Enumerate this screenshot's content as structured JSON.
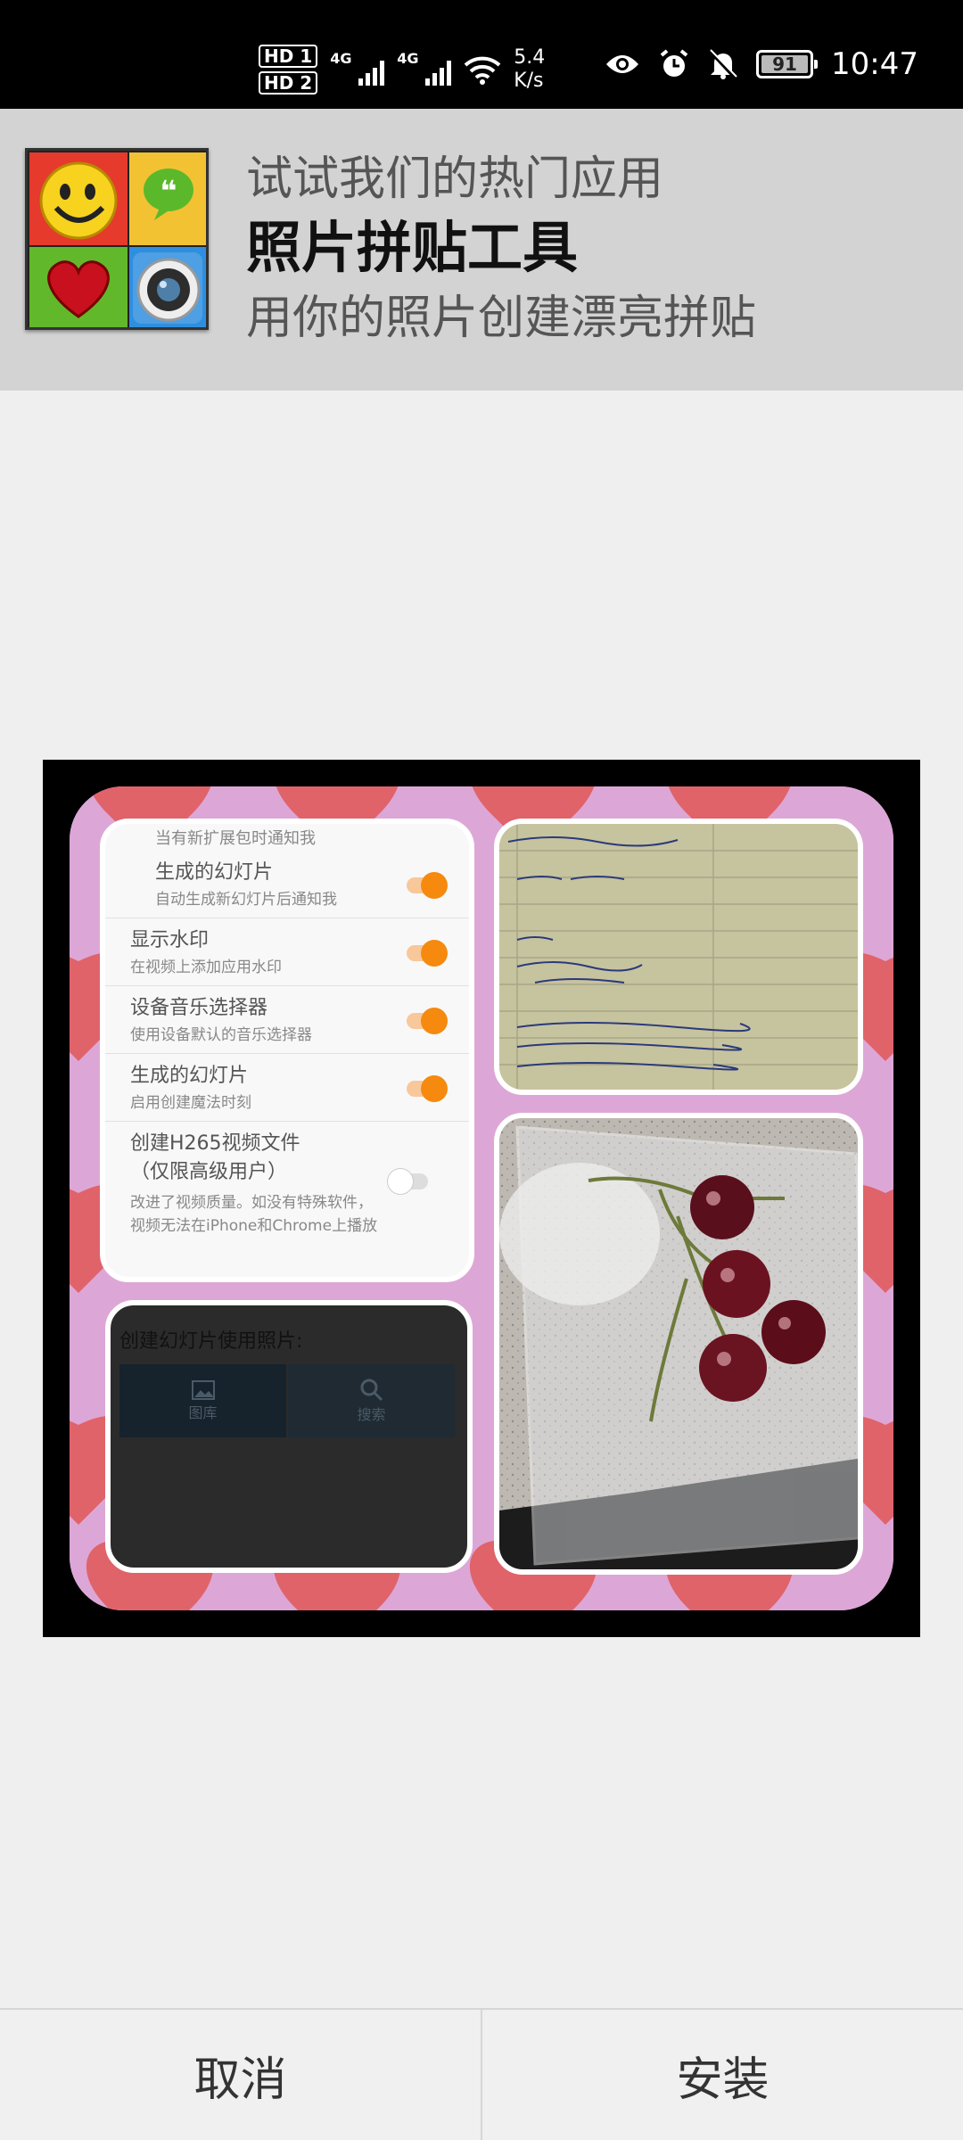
{
  "status_bar": {
    "hd1": "HD 1",
    "hd2": "HD 2",
    "net1": "4G",
    "net2": "4G",
    "speed_value": "5.4",
    "speed_unit": "K/s",
    "battery": "91",
    "time": "10:47",
    "icons": [
      "eye-icon",
      "alarm-icon",
      "bell-off-icon"
    ]
  },
  "banner": {
    "line1": "试试我们的热门应用",
    "app_name": "照片拼贴工具",
    "line3": "用你的照片创建漂亮拼贴"
  },
  "preview": {
    "settings_panel": {
      "top_partial": "当有新扩展包时通知我",
      "rows": [
        {
          "title": "生成的幻灯片",
          "subtitle": "自动生成新幻灯片后通知我",
          "on": true
        },
        {
          "title": "显示水印",
          "subtitle": "在视频上添加应用水印",
          "on": true
        },
        {
          "title": "设备音乐选择器",
          "subtitle": "使用设备默认的音乐选择器",
          "on": true
        },
        {
          "title": "生成的幻灯片",
          "subtitle": "启用创建魔法时刻",
          "on": true
        }
      ],
      "last_row": {
        "title1": "创建H265视频文件",
        "title2": "（仅限高级用户）",
        "sub1": "改进了视频质量。如没有特殊软件，",
        "sub2": "视频无法在iPhone和Chrome上播放",
        "on": false
      }
    },
    "dark_panel": {
      "heading": "创建幻灯片使用照片:",
      "tab1": "图库",
      "tab2": "搜索"
    }
  },
  "buttons": {
    "cancel": "取消",
    "install": "安装"
  },
  "colors": {
    "banner_bg": "#d3d3d3",
    "page_bg": "#efefef",
    "toggle_on": "#f58a0f",
    "collage_bg": "#dca7d6",
    "heart": "#e0636a"
  }
}
